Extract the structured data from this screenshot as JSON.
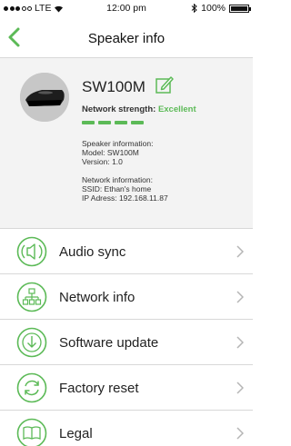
{
  "status_bar": {
    "carrier": "LTE",
    "time": "12:00 pm",
    "battery": "100%"
  },
  "nav": {
    "title": "Speaker info"
  },
  "speaker": {
    "name": "SW100M",
    "strength_label": "Network strength:",
    "strength_value": "Excellent",
    "strength_bars": 4,
    "speaker_info_heading": "Speaker information:",
    "model": "Model: SW100M",
    "version": "Version: 1.0",
    "network_info_heading": "Network information:",
    "ssid": "SSID: Ethan's home",
    "ip": "IP Adress: 192.168.11.87"
  },
  "menu": [
    {
      "label": "Audio sync",
      "icon": "audio-sync-icon"
    },
    {
      "label": "Network info",
      "icon": "network-icon"
    },
    {
      "label": "Software update",
      "icon": "download-icon"
    },
    {
      "label": "Factory reset",
      "icon": "reset-icon"
    },
    {
      "label": "Legal",
      "icon": "book-icon"
    }
  ],
  "colors": {
    "accent": "#5cba57"
  }
}
